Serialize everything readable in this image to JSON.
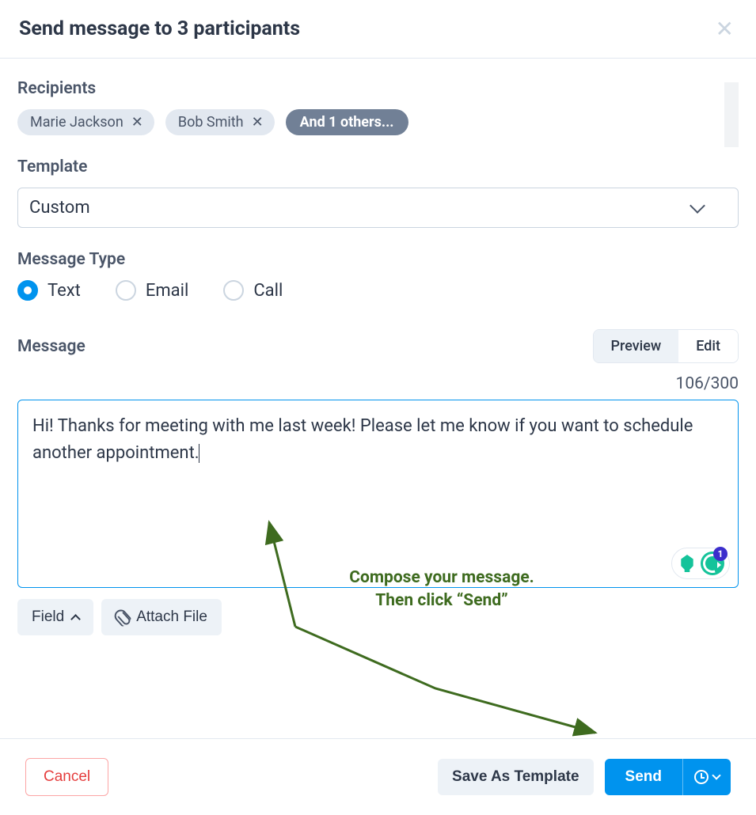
{
  "header": {
    "title": "Send message to 3 participants"
  },
  "recipients": {
    "label": "Recipients",
    "chips": [
      "Marie Jackson",
      "Bob Smith"
    ],
    "more_label": "And 1 others..."
  },
  "template": {
    "label": "Template",
    "value": "Custom"
  },
  "message_type": {
    "label": "Message Type",
    "options": [
      {
        "label": "Text",
        "checked": true
      },
      {
        "label": "Email",
        "checked": false
      },
      {
        "label": "Call",
        "checked": false
      }
    ]
  },
  "message": {
    "label": "Message",
    "preview_label": "Preview",
    "edit_label": "Edit",
    "char_count": "106/300",
    "body": "Hi!  Thanks for meeting with me last week! Please let me know if you want to schedule another appointment."
  },
  "grammarly": {
    "badge_count": "1"
  },
  "toolbar": {
    "field_label": "Field",
    "attach_label": "Attach File"
  },
  "footer": {
    "cancel_label": "Cancel",
    "save_template_label": "Save As Template",
    "send_label": "Send"
  },
  "annotation": {
    "line1": "Compose your message.",
    "line2": "Then click “Send”"
  }
}
